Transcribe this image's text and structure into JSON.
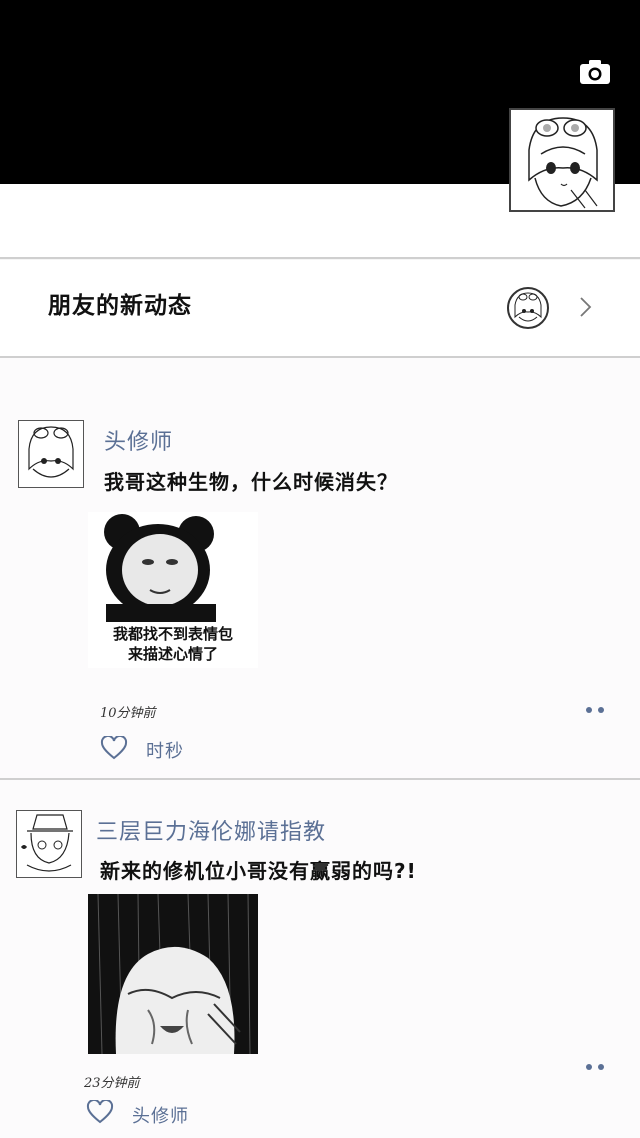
{
  "header": {
    "camera_icon": "camera-icon"
  },
  "friends_updates": {
    "label": "朋友的新动态"
  },
  "posts": [
    {
      "author": "头修师",
      "text": "我哥这种生物，什么时候消失？",
      "image_caption_line1": "我都找不到表情包",
      "image_caption_line2": "来描述心情了",
      "time": "10分钟前",
      "liked_by": "时秒"
    },
    {
      "author": "三层巨力海伦娜请指教",
      "text": "新来的修机位小哥没有赢弱的吗?!",
      "time": "23分钟前",
      "liked_by": "头修师"
    }
  ],
  "colors": {
    "accent": "#5b7095",
    "cover": "#000000"
  }
}
